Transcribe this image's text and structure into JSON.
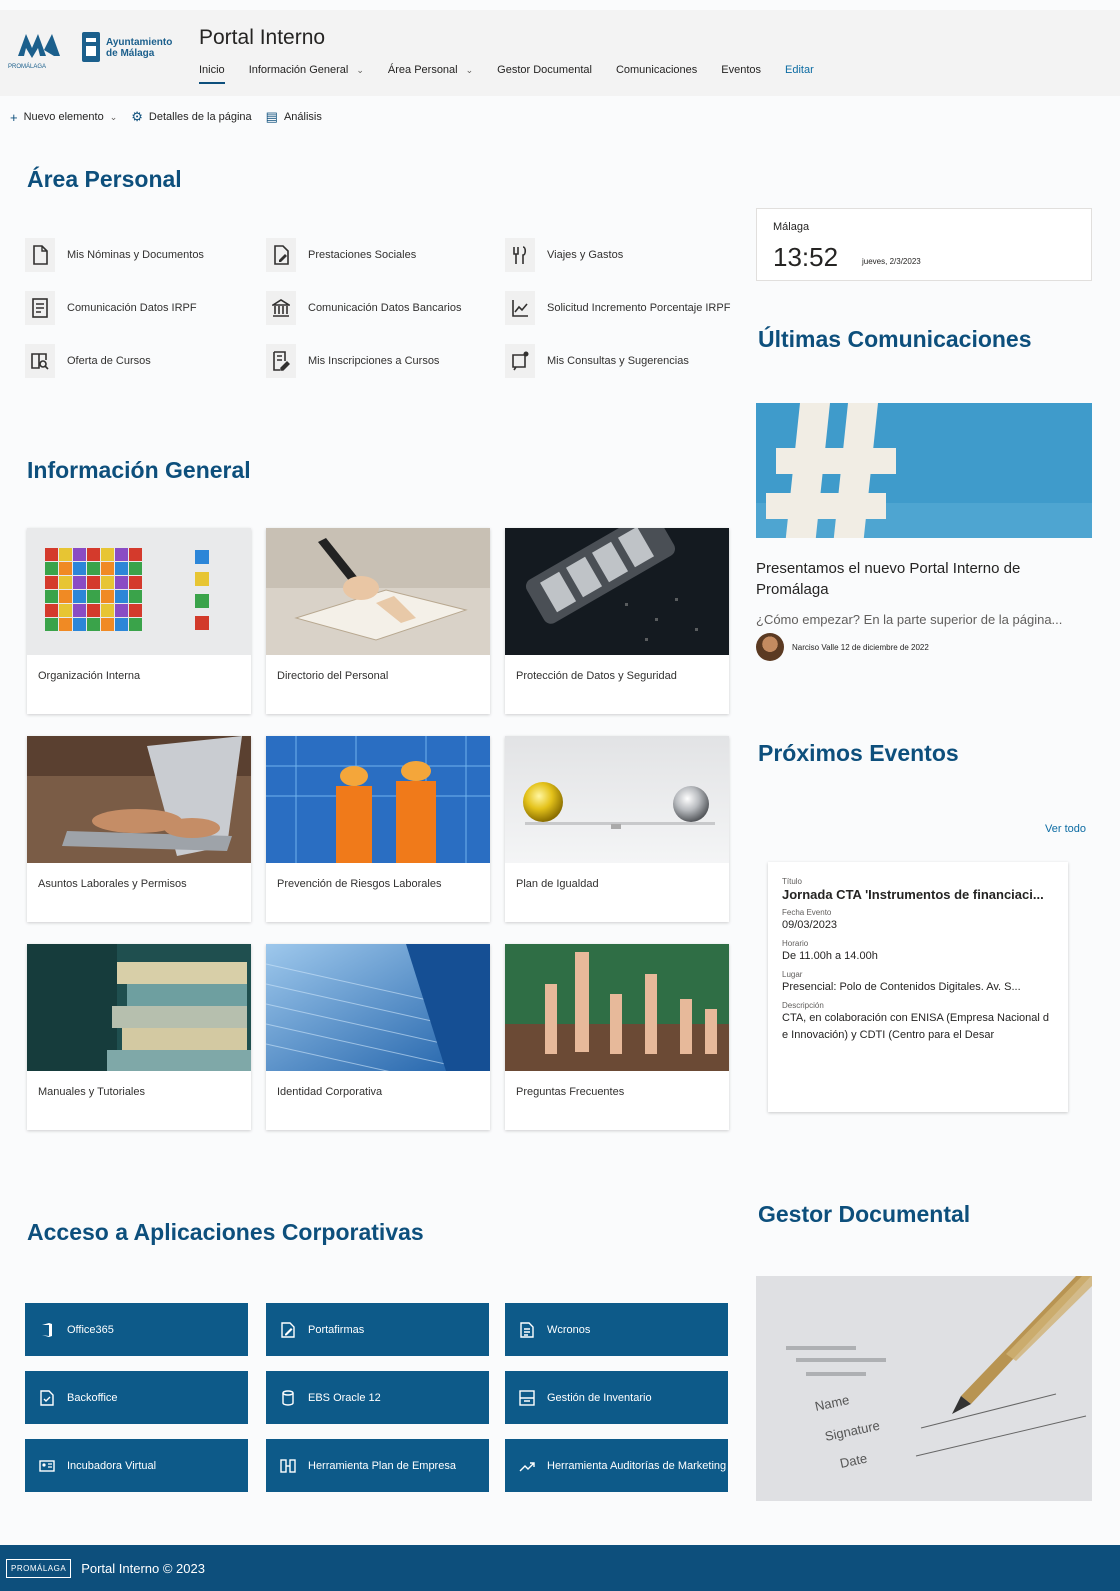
{
  "header": {
    "logo_promalaga": "PROMÁLAGA",
    "logo_ayto_line1": "Ayuntamiento",
    "logo_ayto_line2": "de Málaga",
    "title": "Portal Interno",
    "nav": [
      "Inicio",
      "Información General",
      "Área Personal",
      "Gestor Documental",
      "Comunicaciones",
      "Eventos"
    ],
    "edit": "Editar"
  },
  "cmdbar": {
    "new": "Nuevo elemento",
    "details": "Detalles de la página",
    "analysis": "Análisis"
  },
  "area_personal": {
    "title": "Área Personal",
    "items": [
      "Mis Nóminas y Documentos",
      "Prestaciones Sociales",
      "Viajes y Gastos",
      "Comunicación Datos IRPF",
      "Comunicación Datos Bancarios",
      "Solicitud Incremento Porcentaje IRPF",
      "Oferta de Cursos",
      "Mis Inscripciones a Cursos",
      "Mis Consultas y Sugerencias"
    ]
  },
  "clock": {
    "city": "Málaga",
    "time": "13:52",
    "date": "jueves, 2/3/2023"
  },
  "informacion_general": {
    "title": "Información General",
    "cards": [
      "Organización Interna",
      "Directorio del Personal",
      "Protección de Datos y Seguridad",
      "Asuntos Laborales y Permisos",
      "Prevención de Riesgos Laborales",
      "Plan de Igualdad",
      "Manuales y Tutoriales",
      "Identidad Corporativa",
      "Preguntas Frecuentes"
    ]
  },
  "comunicaciones": {
    "title": "Últimas Comunicaciones",
    "news_title": "Presentamos el nuevo Portal Interno de Promálaga",
    "news_desc": "¿Cómo empezar? En la parte superior de la página...",
    "author": "Narciso Valle 12 de diciembre de 2022"
  },
  "eventos": {
    "title": "Próximos Eventos",
    "ver_todo": "Ver todo",
    "labels": {
      "titulo": "Título",
      "fecha": "Fecha Evento",
      "horario": "Horario",
      "lugar": "Lugar",
      "descripcion": "Descripción"
    },
    "event": {
      "titulo": "Jornada CTA 'Instrumentos de financiaci...",
      "fecha": "09/03/2023",
      "horario": "De 11.00h a 14.00h",
      "lugar": "Presencial: Polo de Contenidos Digitales. Av. S...",
      "descripcion": "CTA, en colaboración con ENISA (Empresa Nacional de Innovación) y CDTI (Centro para el Desar"
    }
  },
  "aplicaciones": {
    "title": "Acceso a Aplicaciones Corporativas",
    "items": [
      "Office365",
      "Portafirmas",
      "Wcronos",
      "Backoffice",
      "EBS Oracle 12",
      "Gestión de Inventario",
      "Incubadora Virtual",
      "Herramienta Plan de Empresa",
      "Herramienta Auditorías de Marketing"
    ]
  },
  "gestor": {
    "title": "Gestor Documental",
    "doc_text": [
      "Name",
      "Signature",
      "Date"
    ]
  },
  "footer": {
    "logo": "PROMÁLAGA",
    "text": "Portal Interno © 2023"
  },
  "colors": {
    "primary": "#0d4f7c",
    "button": "#0d5a89",
    "link": "#0d6ca3"
  }
}
